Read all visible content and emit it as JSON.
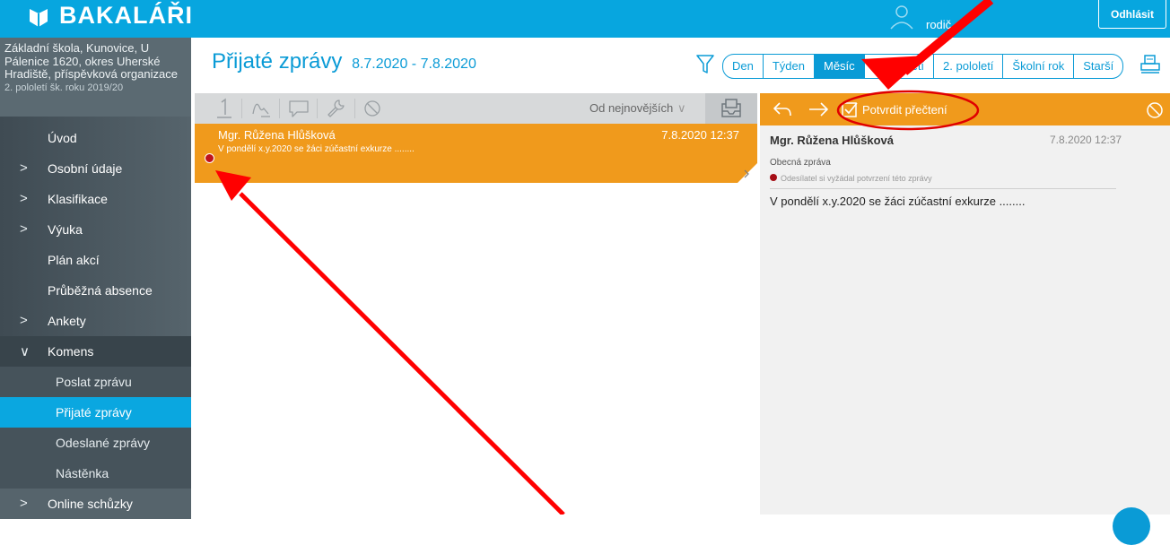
{
  "header": {
    "logo_text": "BAKALÁŘI",
    "user_role": "rodič",
    "logout_label": "Odhlásit"
  },
  "sidebar": {
    "school_name": "Základní škola, Kunovice, U Pálenice 1620, okres Uherské Hradiště, příspěvková organizace",
    "term": "2. pololetí šk. roku 2019/20",
    "items": [
      {
        "label": "Úvod"
      },
      {
        "label": "Osobní údaje",
        "chevron": ">"
      },
      {
        "label": "Klasifikace",
        "chevron": ">"
      },
      {
        "label": "Výuka",
        "chevron": ">"
      },
      {
        "label": "Plán akcí"
      },
      {
        "label": "Průběžná absence"
      },
      {
        "label": "Ankety",
        "chevron": ">"
      },
      {
        "label": "Komens",
        "chevron": "∨"
      },
      {
        "label": "Poslat zprávu"
      },
      {
        "label": "Přijaté zprávy"
      },
      {
        "label": "Odeslané zprávy"
      },
      {
        "label": "Nástěnka"
      },
      {
        "label": "Online schůzky",
        "chevron": ">"
      }
    ]
  },
  "main": {
    "title": "Přijaté zprávy",
    "date_range": "8.7.2020 - 7.8.2020",
    "periods": [
      "Den",
      "Týden",
      "Měsíc",
      "1. pololetí",
      "2. pololetí",
      "Školní rok",
      "Starší"
    ],
    "active_period": "Měsíc",
    "sort_label": "Od nejnovějších"
  },
  "message_list": [
    {
      "sender": "Mgr. Růžena Hlůšková",
      "date": "7.8.2020 12:37",
      "preview": "V pondělí x.y.2020 se žáci zúčastní exkurze ........"
    }
  ],
  "detail": {
    "confirm_label": "Potvrdit přečtení",
    "sender": "Mgr. Růžena Hlůšková",
    "date": "7.8.2020 12:37",
    "type": "Obecná zpráva",
    "read_receipt_note": "Odesílatel si vyžádal potvrzení této zprávy",
    "body": "V pondělí x.y.2020 se žáci zúčastní exkurze ........"
  },
  "colors": {
    "header_blue": "#07a6df",
    "accent_orange": "#f09a1c",
    "annotation_red": "#ff0000",
    "unread_dot": "#c0121c"
  },
  "icons": [
    "bakalari-logo-icon",
    "user-icon",
    "filter-icon",
    "print-icon",
    "reply-icon",
    "forward-icon",
    "checkbox-icon",
    "cancel-icon",
    "envelope-icon"
  ]
}
